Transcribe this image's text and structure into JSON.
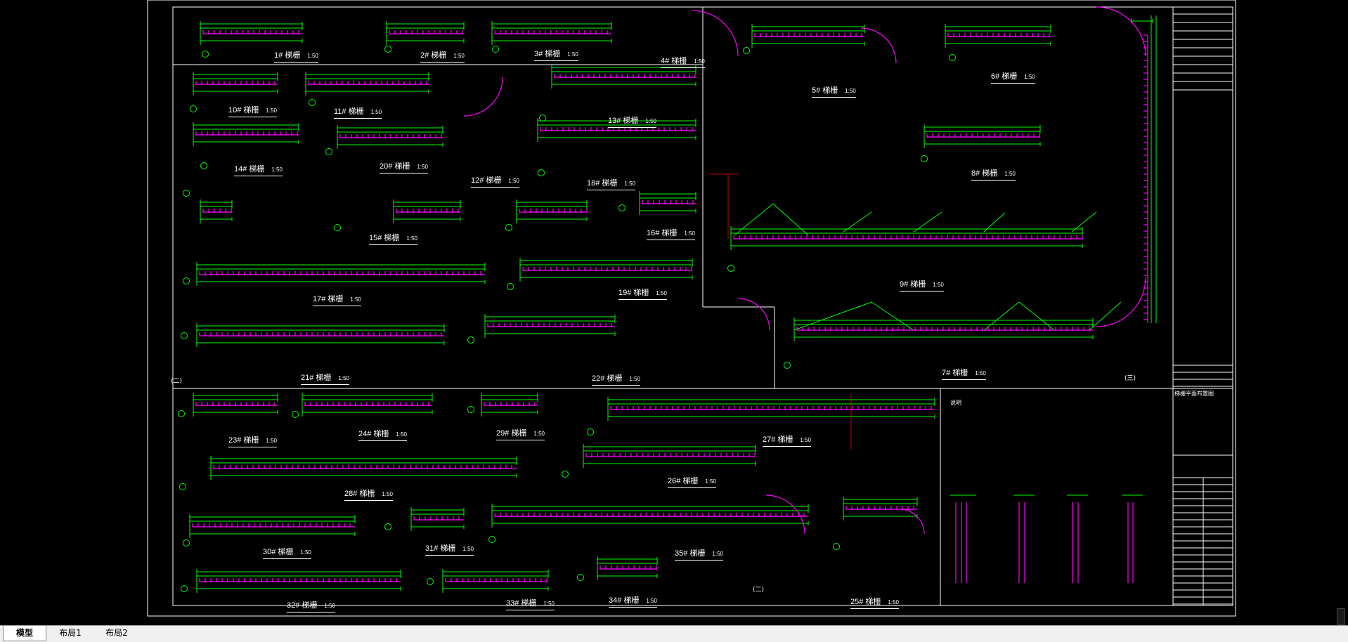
{
  "app": {
    "name": "CAD drawing viewer"
  },
  "layout_tabs": [
    {
      "label": "模型",
      "active": true
    },
    {
      "label": "布局1",
      "active": false
    },
    {
      "label": "布局2",
      "active": false
    }
  ],
  "drawing": {
    "detail_labels": [
      {
        "text": "1# 梯栅",
        "scale": "1:50"
      },
      {
        "text": "2# 梯栅",
        "scale": "1:50"
      },
      {
        "text": "3# 梯栅",
        "scale": "1:50"
      },
      {
        "text": "4# 梯栅",
        "scale": "1:50"
      },
      {
        "text": "5# 梯栅",
        "scale": "1:50"
      },
      {
        "text": "6# 梯栅",
        "scale": "1:50"
      },
      {
        "text": "7# 梯栅",
        "scale": "1:50"
      },
      {
        "text": "8# 梯栅",
        "scale": "1:50"
      },
      {
        "text": "9# 梯栅",
        "scale": "1:50"
      },
      {
        "text": "10# 梯栅",
        "scale": "1:50"
      },
      {
        "text": "11# 梯栅",
        "scale": "1:50"
      },
      {
        "text": "12# 梯栅",
        "scale": "1:50"
      },
      {
        "text": "13# 梯栅",
        "scale": "1:50"
      },
      {
        "text": "14# 梯栅",
        "scale": "1:50"
      },
      {
        "text": "15# 梯栅",
        "scale": "1:50"
      },
      {
        "text": "16# 梯栅",
        "scale": "1:50"
      },
      {
        "text": "17# 梯栅",
        "scale": "1:50"
      },
      {
        "text": "18# 梯栅",
        "scale": "1:50"
      },
      {
        "text": "19# 梯栅",
        "scale": "1:50"
      },
      {
        "text": "20# 梯栅",
        "scale": "1:50"
      },
      {
        "text": "21# 梯栅",
        "scale": "1:50"
      },
      {
        "text": "22# 梯栅",
        "scale": "1:50"
      },
      {
        "text": "23# 梯栅",
        "scale": "1:50"
      },
      {
        "text": "24# 梯栅",
        "scale": "1:50"
      },
      {
        "text": "25# 梯栅",
        "scale": "1:50"
      },
      {
        "text": "26# 梯栅",
        "scale": "1:50"
      },
      {
        "text": "27# 梯栅",
        "scale": "1:50"
      },
      {
        "text": "28# 梯栅",
        "scale": "1:50"
      },
      {
        "text": "29# 梯栅",
        "scale": "1:50"
      },
      {
        "text": "30# 梯栅",
        "scale": "1:50"
      },
      {
        "text": "31# 梯栅",
        "scale": "1:50"
      },
      {
        "text": "32# 梯栅",
        "scale": "1:50"
      },
      {
        "text": "33# 梯栅",
        "scale": "1:50"
      },
      {
        "text": "34# 梯栅",
        "scale": "1:50"
      },
      {
        "text": "35# 梯栅",
        "scale": "1:50"
      }
    ],
    "block_labels": {
      "left": "(二)",
      "right": "(三)",
      "bottom": "(二)"
    },
    "notes_title": "说明",
    "title_block_caption": "梯栅平面布置图"
  },
  "colors": {
    "background": "#000000",
    "line_green": "#00ff00",
    "line_magenta": "#ff00ff",
    "frame_white": "#ffffff",
    "axis_red": "#ff0000"
  }
}
